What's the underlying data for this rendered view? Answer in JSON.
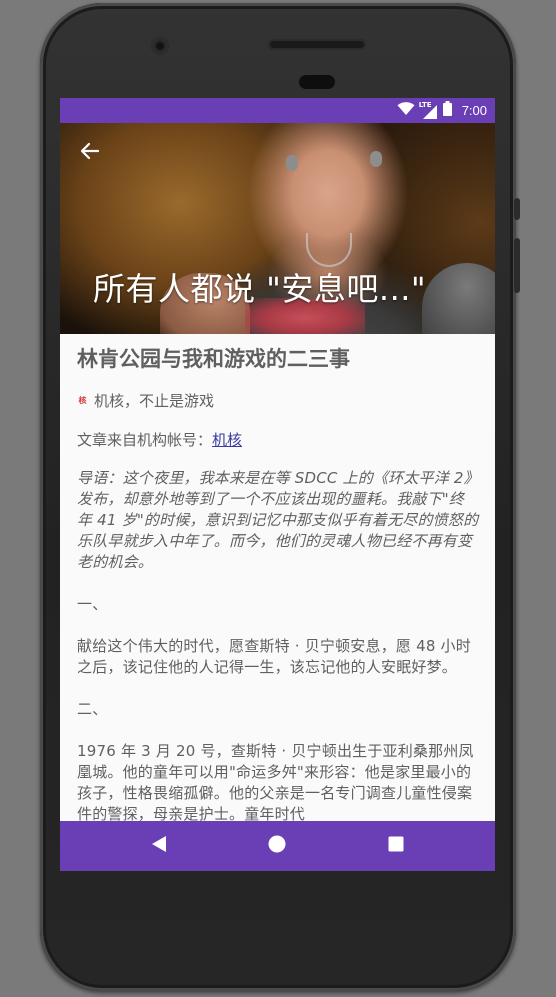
{
  "status_bar": {
    "time": "7:00",
    "network_label": "LTE",
    "icons": [
      "wifi-icon",
      "lte-signal-icon",
      "battery-icon"
    ]
  },
  "header": {
    "back_icon": "arrow-back-icon",
    "title": "所有人都说 \"安息吧...\""
  },
  "article": {
    "title": "林肯公园与我和游戏的二三事",
    "source": {
      "logo_text": "核",
      "label": "机核，不止是游戏"
    },
    "org_prefix": "文章来自机构帐号：",
    "org_link": "机核",
    "intro": "导语：这个夜里，我本来是在等 SDCC 上的《环太平洋 2》发布，却意外地等到了一个不应该出现的噩耗。我敲下\"终年 41 岁\"的时候，意识到记忆中那支似乎有着无尽的愤怒的乐队早就步入中年了。而今，他们的灵魂人物已经不再有变老的机会。",
    "section1_heading": "一、",
    "section1_text": "献给这个伟大的时代，愿查斯特 · 贝宁顿安息，愿 48 小时之后，该记住他的人记得一生，该忘记他的人安眠好梦。",
    "section2_heading": "二、",
    "section2_text": "1976 年 3 月 20 号，查斯特 · 贝宁顿出生于亚利桑那州凤凰城。他的童年可以用\"命运多舛\"来形容：他是家里最小的孩子，性格畏缩孤僻。他的父亲是一名专门调查儿童性侵案件的警探，母亲是护士。童年时代"
  },
  "nav_bar": {
    "buttons": [
      "back-triangle-icon",
      "home-circle-icon",
      "recents-square-icon"
    ]
  },
  "colors": {
    "primary": "#6a3fb5",
    "background": "#fafafa",
    "text": "#606060",
    "link": "#3a3aa0"
  }
}
